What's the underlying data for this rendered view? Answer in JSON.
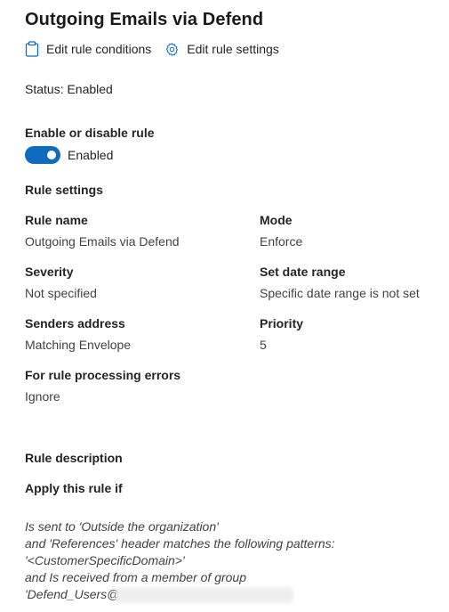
{
  "page_title": "Outgoing Emails via Defend",
  "toolbar": {
    "edit_conditions_label": "Edit rule conditions",
    "edit_settings_label": "Edit rule settings"
  },
  "status_text": "Status: Enabled",
  "enable_section": {
    "label": "Enable or disable rule",
    "toggle_state": "Enabled",
    "toggle_on": true,
    "accent_color": "#0f6cbd"
  },
  "rule_settings": {
    "heading": "Rule settings",
    "rule_name_label": "Rule name",
    "rule_name_value": "Outgoing Emails via Defend",
    "mode_label": "Mode",
    "mode_value": "Enforce",
    "severity_label": "Severity",
    "severity_value": "Not specified",
    "date_range_label": "Set date range",
    "date_range_value": "Specific date range is not set",
    "senders_label": "Senders address",
    "senders_value": "Matching Envelope",
    "priority_label": "Priority",
    "priority_value": "5",
    "errors_label": "For rule processing errors",
    "errors_value": "Ignore"
  },
  "rule_description": {
    "heading": "Rule description",
    "apply_heading": "Apply this rule if",
    "lines": [
      "Is sent to 'Outside the organization'",
      "and 'References' header matches the following patterns:",
      "'<CustomerSpecificDomain>'",
      "and Is received from a member of group",
      "'Defend_Users@"
    ]
  }
}
